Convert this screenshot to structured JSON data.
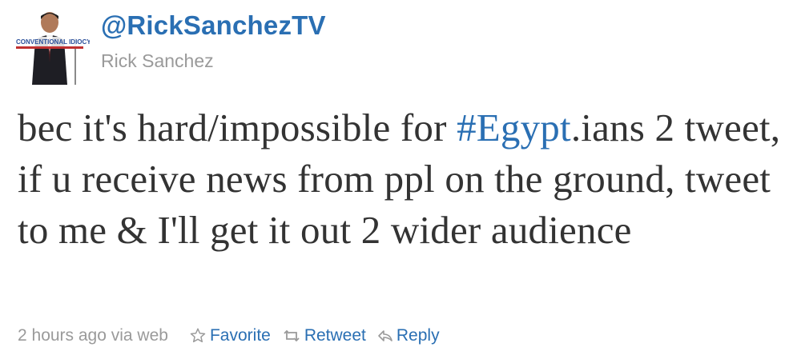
{
  "user": {
    "screen_name": "@RickSanchezTV",
    "real_name": "Rick Sanchez",
    "avatar_banner": "CONVENTIONAL IDIOCY"
  },
  "tweet": {
    "text_before": "bec it's hard/impossible for ",
    "hashtag": "#Egypt",
    "text_after": ".ians 2 tweet, if u receive news from ppl on the ground, tweet to me & I'll get it out 2 wider audience"
  },
  "meta": {
    "timestamp": "2 hours ago via web"
  },
  "actions": {
    "favorite_label": "Favorite",
    "retweet_label": "Retweet",
    "reply_label": "Reply"
  },
  "icons": {
    "favorite": "star-outline-icon",
    "retweet": "retweet-icon",
    "reply": "reply-arrow-icon"
  },
  "colors": {
    "link": "#2a6fb3",
    "text": "#333333",
    "muted": "#9a9a9a",
    "background": "#ffffff"
  }
}
